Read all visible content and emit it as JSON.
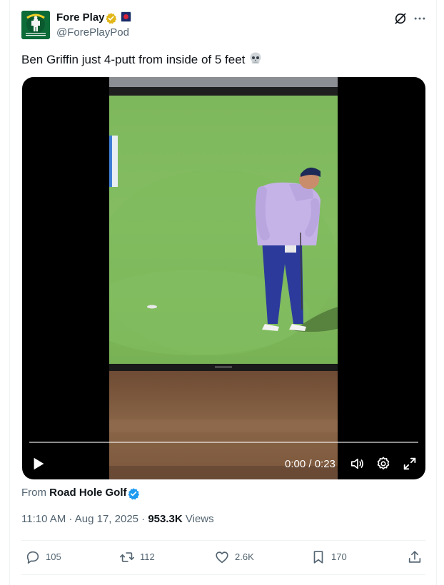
{
  "author": {
    "display_name": "Fore Play",
    "handle": "@ForePlayPod",
    "avatar_text": "FORE PLAY",
    "verified_badge_color": "#e2b719"
  },
  "header": {
    "grok_icon": "grok-icon",
    "more_icon": "more-dots-icon"
  },
  "tweet": {
    "text": "Ben Griffin just 4-putt from inside of 5 feet",
    "emoji": "skull-emoji"
  },
  "media": {
    "type": "video",
    "time": "0:00 / 0:23",
    "progress": 0,
    "controls": [
      "play-icon",
      "volume-icon",
      "settings-icon",
      "fullscreen-icon"
    ]
  },
  "attribution": {
    "prefix": "From",
    "source": "Road Hole Golf",
    "verified_badge_color": "#1d9bf0"
  },
  "meta": {
    "timestamp": "11:10 AM · Aug 17, 2025 · ",
    "views_count": "953.3K",
    "views_label": " Views"
  },
  "actions": {
    "reply_count": "105",
    "retweet_count": "112",
    "like_count": "2.6K",
    "bookmark_count": "170"
  },
  "colors": {
    "text_primary": "#0f1419",
    "text_secondary": "#536471",
    "accent_blue": "#1d9bf0"
  }
}
